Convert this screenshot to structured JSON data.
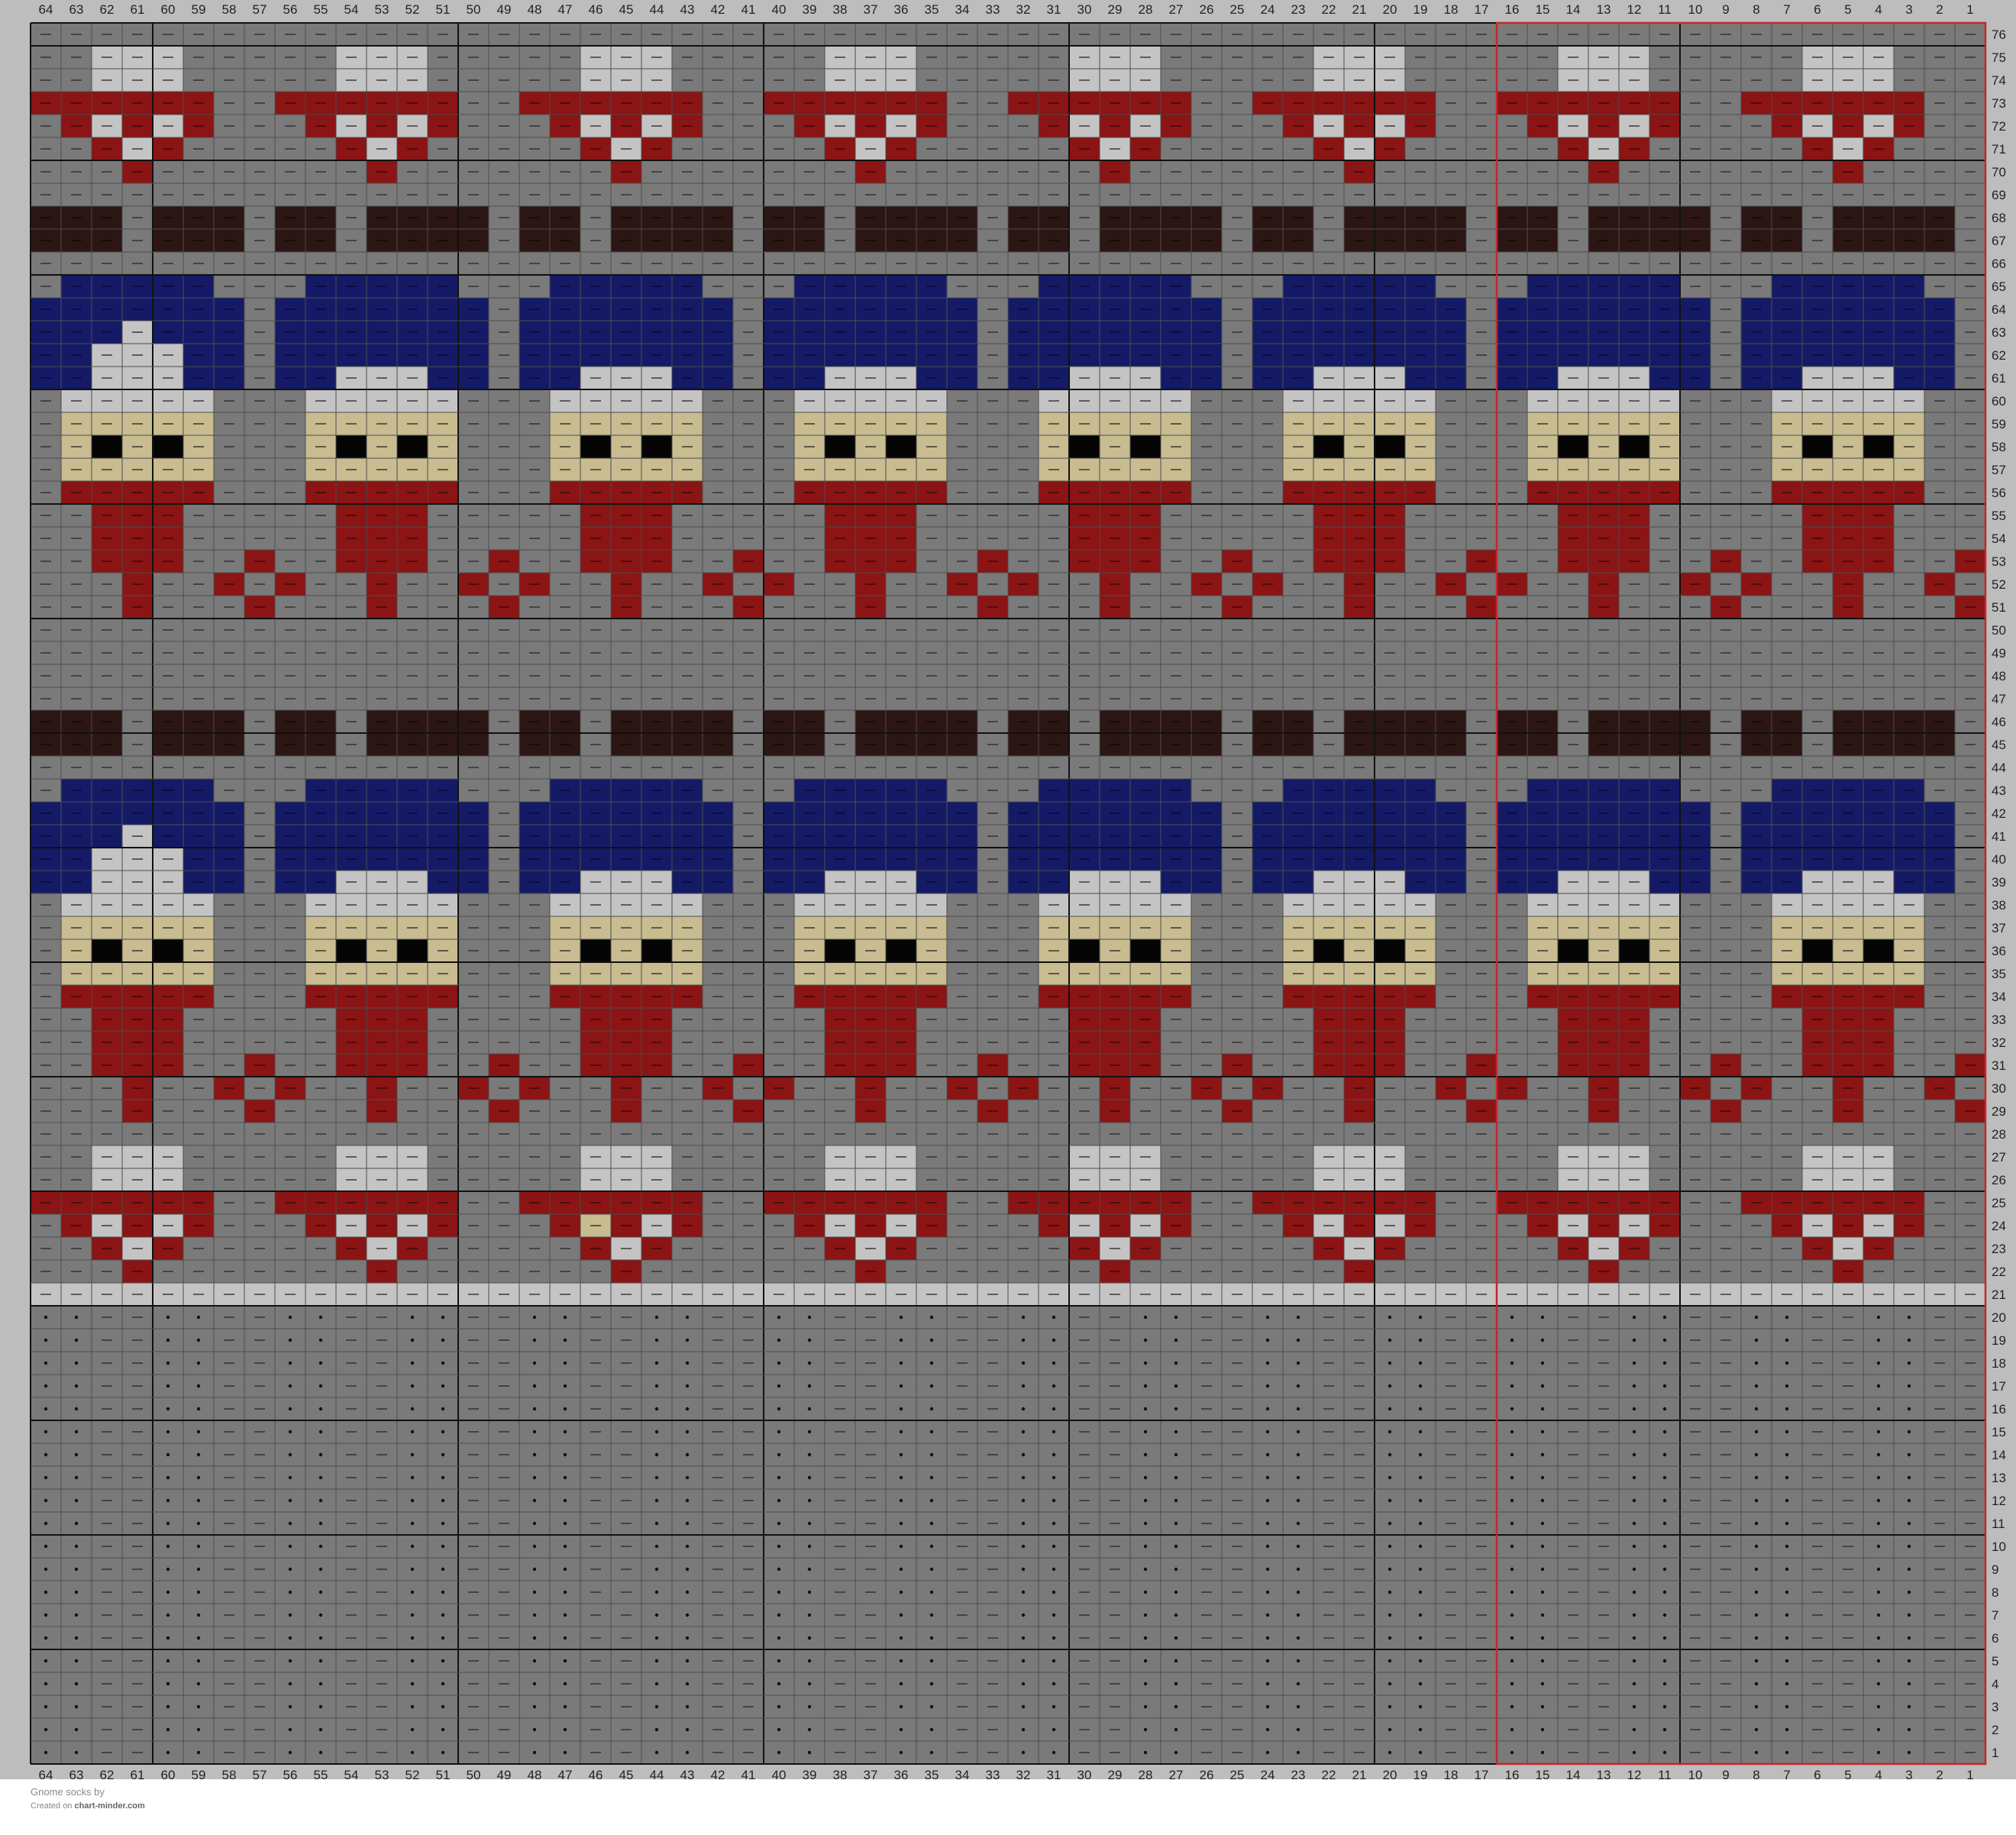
{
  "chart": {
    "columns": 64,
    "rows": 76,
    "colors": {
      "background": "#7a7a7a",
      "light": "#c4c4c4",
      "red": "#8b1414",
      "brown": "#2b1614",
      "navy": "#141a66",
      "skin": "#c8bc90",
      "eye": "#050505",
      "chart_border": "#c2282c",
      "grid_line": "#4d4d4d",
      "major_grid_line": "#111111"
    },
    "symbols": {
      "knit": "dash",
      "purl": "dot"
    },
    "rib_rows": [
      1,
      20
    ],
    "pattern_repeat_columns": [
      1,
      16
    ],
    "motif_repeat_width": 8,
    "gnome_band_bottom_rows": [
      29,
      51
    ],
    "edge_band_rows": [
      21,
      70
    ],
    "odd_cells": [
      {
        "col": 46,
        "row": 24,
        "color": "skin"
      }
    ]
  },
  "footer": {
    "title": "Gnome socks by",
    "credit_prefix": "Created on",
    "credit_site": "chart-minder.com"
  }
}
